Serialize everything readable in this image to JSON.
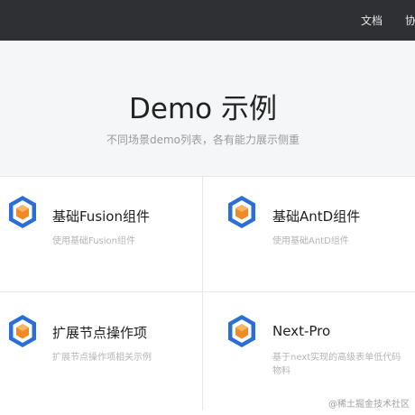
{
  "header": {
    "nav": [
      {
        "label": "文档"
      },
      {
        "label": "协"
      }
    ]
  },
  "hero": {
    "title": "Demo 示例",
    "subtitle": "不同场景demo列表，各有能力展示侧重"
  },
  "cards": [
    {
      "title": "基础Fusion组件",
      "desc": "使用基础Fusion组件",
      "icon": "cube-icon"
    },
    {
      "title": "基础AntD组件",
      "desc": "使用基础AntD组件",
      "icon": "cube-icon"
    },
    {
      "title": "扩展节点操作项",
      "desc": "扩展节点操作项相关示例",
      "icon": "cube-icon"
    },
    {
      "title": "Next-Pro",
      "desc": "基于next实现的高级表单低代码物料",
      "icon": "cube-icon"
    }
  ],
  "watermark": "@稀土掘金技术社区",
  "colors": {
    "topbar": "#2f3033",
    "icon_outer": "#2b6fd6",
    "icon_inner": "#f08a24"
  }
}
